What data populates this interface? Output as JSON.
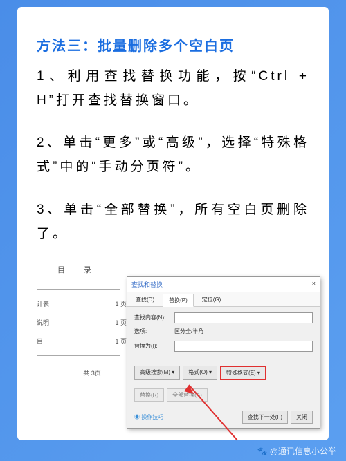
{
  "title": "方法三：批量删除多个空白页",
  "steps": {
    "s1": "1、利用查找替换功能，按“Ctrl + H”打开查找替换窗口。",
    "s2": "2、单击“更多”或“高级”，选择“特殊格式”中的“手动分页符”。",
    "s3": "3、单击“全部替换”，所有空白页删除了。"
  },
  "doc": {
    "heading": "目 录",
    "rows": [
      {
        "l": "计表",
        "r": "1 页"
      },
      {
        "l": "说明",
        "r": "1 页"
      },
      {
        "l": "目",
        "r": "1 页"
      }
    ],
    "footer": "共 3页"
  },
  "dialog": {
    "title": "查找和替换",
    "close": "×",
    "tabs": {
      "t1": "查找(D)",
      "t2": "替换(P)",
      "t3": "定位(G)"
    },
    "find_label": "查找内容(N):",
    "option_label": "选项:",
    "option_value": "区分全/半角",
    "replace_label": "替换为(I):",
    "btn_adv": "高级搜索(M) ▾",
    "btn_fmt": "格式(O) ▾",
    "btn_special": "特殊格式(E) ▾",
    "btn_replace": "替换(R)",
    "btn_replace_all": "全部替换(A)",
    "hint": "◉ 操作技巧",
    "btn_findnext": "查找下一处(F)",
    "btn_close": "关闭"
  },
  "watermark": "🐾 @通讯信息小公举"
}
